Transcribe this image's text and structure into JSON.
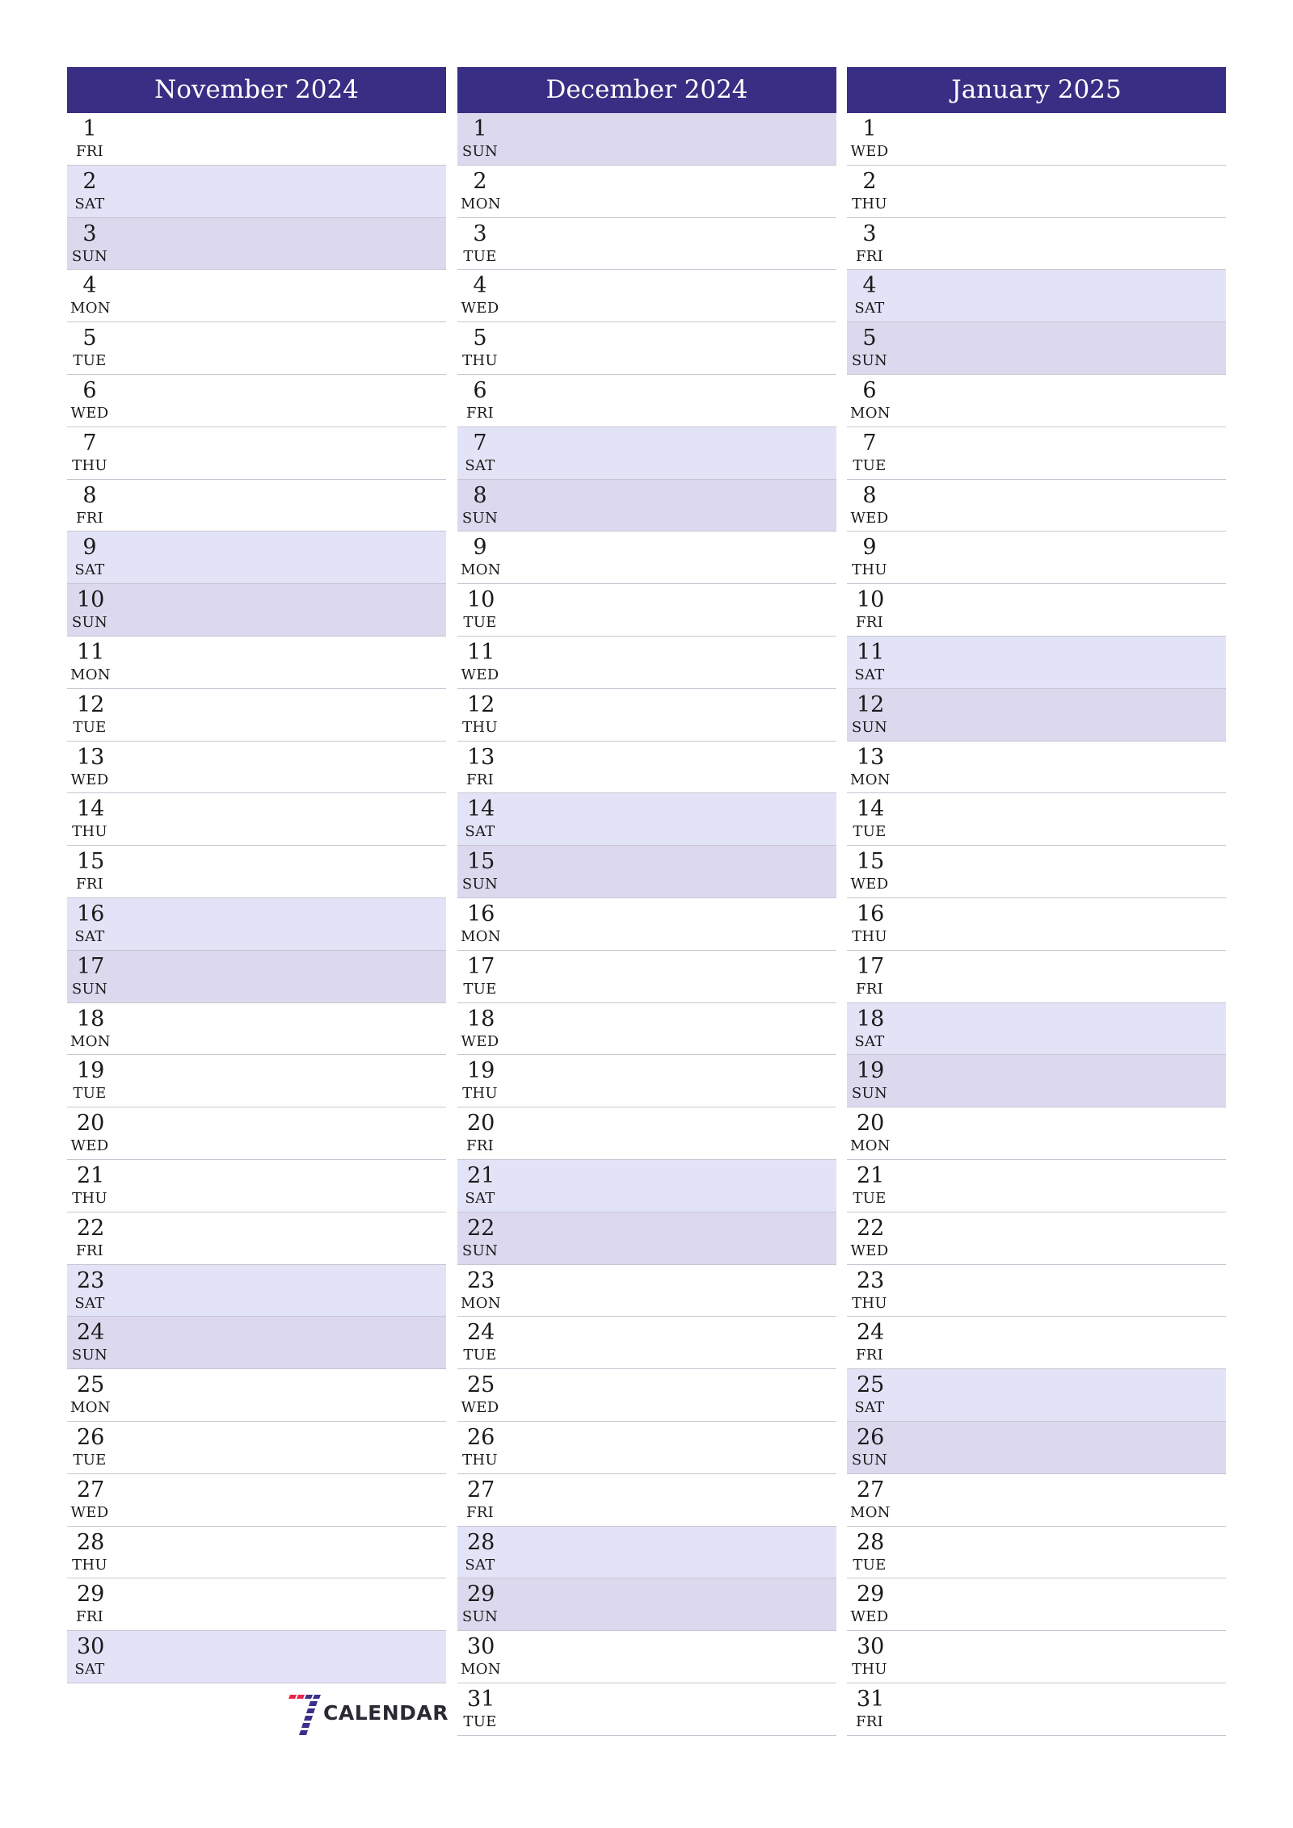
{
  "months": [
    {
      "title": "November 2024",
      "days": [
        {
          "n": "1",
          "d": "FRI"
        },
        {
          "n": "2",
          "d": "SAT"
        },
        {
          "n": "3",
          "d": "SUN"
        },
        {
          "n": "4",
          "d": "MON"
        },
        {
          "n": "5",
          "d": "TUE"
        },
        {
          "n": "6",
          "d": "WED"
        },
        {
          "n": "7",
          "d": "THU"
        },
        {
          "n": "8",
          "d": "FRI"
        },
        {
          "n": "9",
          "d": "SAT"
        },
        {
          "n": "10",
          "d": "SUN"
        },
        {
          "n": "11",
          "d": "MON"
        },
        {
          "n": "12",
          "d": "TUE"
        },
        {
          "n": "13",
          "d": "WED"
        },
        {
          "n": "14",
          "d": "THU"
        },
        {
          "n": "15",
          "d": "FRI"
        },
        {
          "n": "16",
          "d": "SAT"
        },
        {
          "n": "17",
          "d": "SUN"
        },
        {
          "n": "18",
          "d": "MON"
        },
        {
          "n": "19",
          "d": "TUE"
        },
        {
          "n": "20",
          "d": "WED"
        },
        {
          "n": "21",
          "d": "THU"
        },
        {
          "n": "22",
          "d": "FRI"
        },
        {
          "n": "23",
          "d": "SAT"
        },
        {
          "n": "24",
          "d": "SUN"
        },
        {
          "n": "25",
          "d": "MON"
        },
        {
          "n": "26",
          "d": "TUE"
        },
        {
          "n": "27",
          "d": "WED"
        },
        {
          "n": "28",
          "d": "THU"
        },
        {
          "n": "29",
          "d": "FRI"
        },
        {
          "n": "30",
          "d": "SAT"
        }
      ]
    },
    {
      "title": "December 2024",
      "days": [
        {
          "n": "1",
          "d": "SUN"
        },
        {
          "n": "2",
          "d": "MON"
        },
        {
          "n": "3",
          "d": "TUE"
        },
        {
          "n": "4",
          "d": "WED"
        },
        {
          "n": "5",
          "d": "THU"
        },
        {
          "n": "6",
          "d": "FRI"
        },
        {
          "n": "7",
          "d": "SAT"
        },
        {
          "n": "8",
          "d": "SUN"
        },
        {
          "n": "9",
          "d": "MON"
        },
        {
          "n": "10",
          "d": "TUE"
        },
        {
          "n": "11",
          "d": "WED"
        },
        {
          "n": "12",
          "d": "THU"
        },
        {
          "n": "13",
          "d": "FRI"
        },
        {
          "n": "14",
          "d": "SAT"
        },
        {
          "n": "15",
          "d": "SUN"
        },
        {
          "n": "16",
          "d": "MON"
        },
        {
          "n": "17",
          "d": "TUE"
        },
        {
          "n": "18",
          "d": "WED"
        },
        {
          "n": "19",
          "d": "THU"
        },
        {
          "n": "20",
          "d": "FRI"
        },
        {
          "n": "21",
          "d": "SAT"
        },
        {
          "n": "22",
          "d": "SUN"
        },
        {
          "n": "23",
          "d": "MON"
        },
        {
          "n": "24",
          "d": "TUE"
        },
        {
          "n": "25",
          "d": "WED"
        },
        {
          "n": "26",
          "d": "THU"
        },
        {
          "n": "27",
          "d": "FRI"
        },
        {
          "n": "28",
          "d": "SAT"
        },
        {
          "n": "29",
          "d": "SUN"
        },
        {
          "n": "30",
          "d": "MON"
        },
        {
          "n": "31",
          "d": "TUE"
        }
      ]
    },
    {
      "title": "January 2025",
      "days": [
        {
          "n": "1",
          "d": "WED"
        },
        {
          "n": "2",
          "d": "THU"
        },
        {
          "n": "3",
          "d": "FRI"
        },
        {
          "n": "4",
          "d": "SAT"
        },
        {
          "n": "5",
          "d": "SUN"
        },
        {
          "n": "6",
          "d": "MON"
        },
        {
          "n": "7",
          "d": "TUE"
        },
        {
          "n": "8",
          "d": "WED"
        },
        {
          "n": "9",
          "d": "THU"
        },
        {
          "n": "10",
          "d": "FRI"
        },
        {
          "n": "11",
          "d": "SAT"
        },
        {
          "n": "12",
          "d": "SUN"
        },
        {
          "n": "13",
          "d": "MON"
        },
        {
          "n": "14",
          "d": "TUE"
        },
        {
          "n": "15",
          "d": "WED"
        },
        {
          "n": "16",
          "d": "THU"
        },
        {
          "n": "17",
          "d": "FRI"
        },
        {
          "n": "18",
          "d": "SAT"
        },
        {
          "n": "19",
          "d": "SUN"
        },
        {
          "n": "20",
          "d": "MON"
        },
        {
          "n": "21",
          "d": "TUE"
        },
        {
          "n": "22",
          "d": "WED"
        },
        {
          "n": "23",
          "d": "THU"
        },
        {
          "n": "24",
          "d": "FRI"
        },
        {
          "n": "25",
          "d": "SAT"
        },
        {
          "n": "26",
          "d": "SUN"
        },
        {
          "n": "27",
          "d": "MON"
        },
        {
          "n": "28",
          "d": "TUE"
        },
        {
          "n": "29",
          "d": "WED"
        },
        {
          "n": "30",
          "d": "THU"
        },
        {
          "n": "31",
          "d": "FRI"
        }
      ]
    }
  ],
  "colors": {
    "header_bg": "#382f84",
    "saturday_bg": "#e3e3f7",
    "sunday_bg": "#dcd8ee",
    "logo_red": "#e8254a",
    "logo_blue": "#3a2f8a"
  },
  "logo": {
    "icon": "seven-logo-icon",
    "text": "CALENDAR"
  }
}
